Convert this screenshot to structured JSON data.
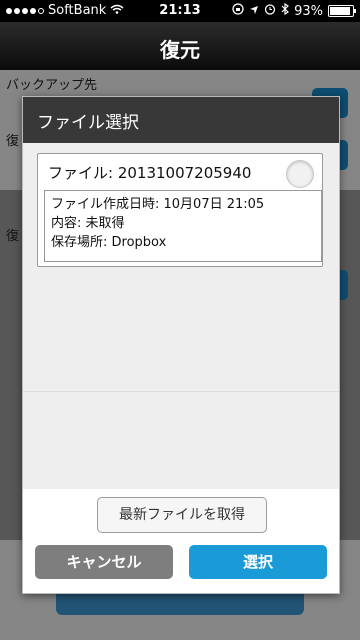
{
  "status_bar": {
    "carrier": "SoftBank",
    "time": "21:13",
    "battery": "93%",
    "signal_icon": "signal-dots-icon",
    "wifi_icon": "wifi-icon"
  },
  "nav": {
    "title": "復元"
  },
  "background": {
    "backup_label": "バックアップ先",
    "stub_1": "復",
    "stub_2": "復"
  },
  "dialog": {
    "title": "ファイル選択",
    "file": {
      "name": "ファイル: 20131007205940",
      "created": "ファイル作成日時: 10月07日 21:05",
      "content": "内容: 未取得",
      "location": "保存場所: Dropbox"
    },
    "fetch_button": "最新ファイルを取得",
    "cancel_button": "キャンセル",
    "select_button": "選択"
  },
  "colors": {
    "accent": "#1a9ad6",
    "cancel": "#7e7e7e",
    "header": "#383838"
  }
}
